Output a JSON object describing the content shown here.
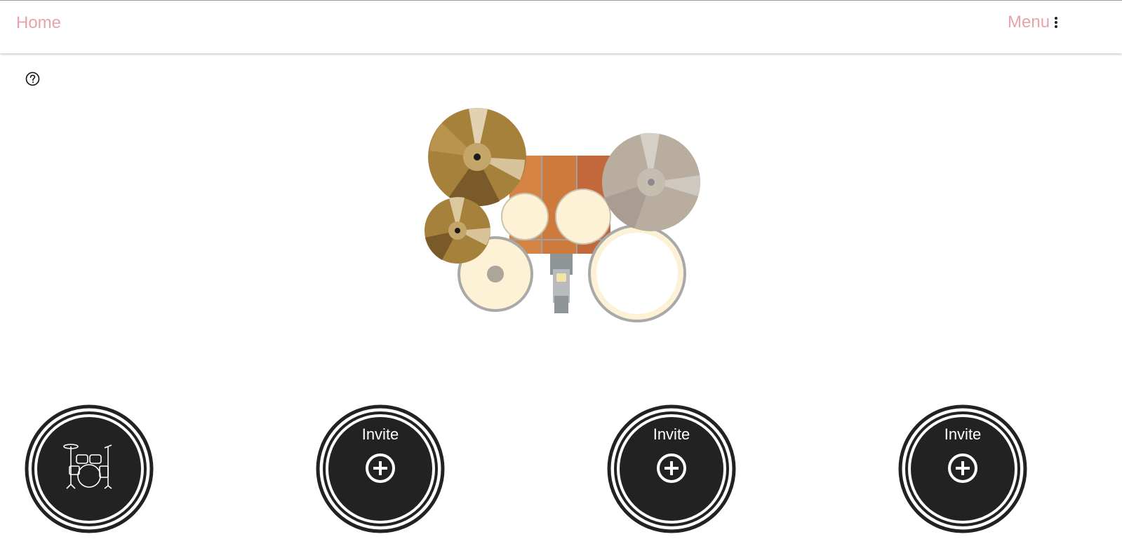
{
  "header": {
    "home_label": "Home",
    "menu_label": "Menu",
    "accent_color": "#e8a3ad",
    "menu_icon": "kebab-vertical-icon"
  },
  "help": {
    "icon": "question-circle-icon"
  },
  "drumkit": {
    "icons": [
      "crash-cymbal-icon",
      "hihat-cymbal-icon",
      "ride-cymbal-icon",
      "tom-drum-icon",
      "snare-drum-icon",
      "floor-tom-icon",
      "kick-pedal-icon"
    ],
    "colors": {
      "cymbal_gold": "#a5813c",
      "cymbal_silver": "#b8ad9f",
      "shell_orange": "#c8733a",
      "drumhead": "#fdf2d6"
    }
  },
  "slots": [
    {
      "label": "",
      "icon": "drum-kit-icon"
    },
    {
      "label": "Invite",
      "icon": "plus-circle-icon"
    },
    {
      "label": "Invite",
      "icon": "plus-circle-icon"
    },
    {
      "label": "Invite",
      "icon": "plus-circle-icon"
    }
  ],
  "slot_color": "#222222"
}
